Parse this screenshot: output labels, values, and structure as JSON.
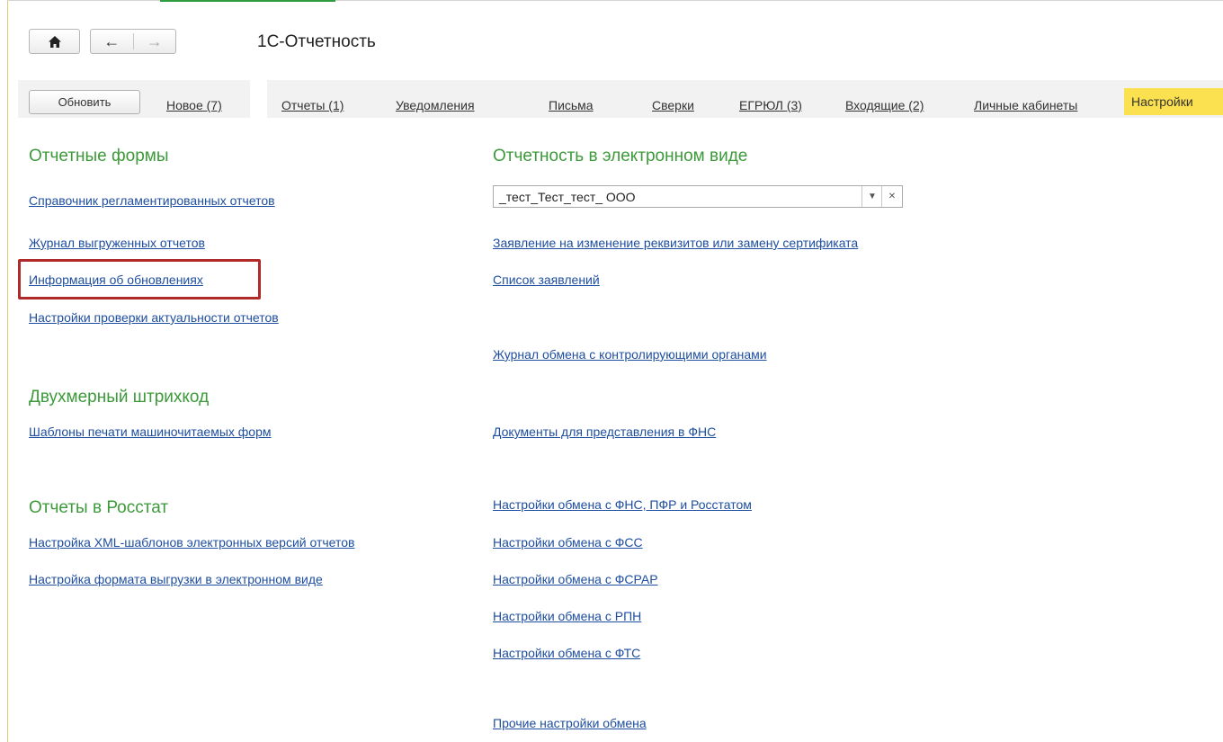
{
  "app": {
    "title": "1С-Отчетность"
  },
  "toolbar": {
    "refresh_label": "Обновить",
    "new_label": "Новое (7)"
  },
  "tabs": [
    {
      "label": "Отчеты (1)"
    },
    {
      "label": "Уведомления"
    },
    {
      "label": "Письма"
    },
    {
      "label": "Сверки"
    },
    {
      "label": "ЕГРЮЛ (3)"
    },
    {
      "label": "Входящие (2)"
    },
    {
      "label": "Личные кабинеты"
    },
    {
      "label": "Настройки"
    }
  ],
  "left": {
    "report_forms": {
      "title": "Отчетные формы",
      "links": [
        "Справочник регламентированных отчетов",
        "Журнал выгруженных отчетов",
        "Информация об обновлениях",
        "Настройки проверки актуальности отчетов"
      ]
    },
    "barcode": {
      "title": "Двухмерный штрихкод",
      "links": [
        "Шаблоны печати машиночитаемых форм"
      ]
    },
    "rosstat": {
      "title": "Отчеты в Росстат",
      "links": [
        "Настройка XML-шаблонов электронных версий отчетов",
        "Настройка формата выгрузки в электронном виде"
      ]
    }
  },
  "right": {
    "title": "Отчетность в электронном виде",
    "organization": {
      "value": "_тест_Тест_тест_ ООО"
    },
    "links": [
      "Заявление на изменение реквизитов или замену сертификата",
      "Список заявлений",
      "Журнал обмена с контролирующими органами",
      "Документы для представления в ФНС",
      "Настройки обмена с ФНС, ПФР и Росстатом",
      "Настройки обмена с ФСС",
      "Настройки обмена с ФСРАР",
      "Настройки обмена с РПН",
      "Настройки обмена с ФТС",
      "Прочие настройки обмена"
    ]
  },
  "icons": {
    "home": "home-icon",
    "back": "arrow-left-icon",
    "forward": "arrow-right-icon",
    "dropdown": "chevron-down-icon",
    "clear": "close-icon"
  },
  "colors": {
    "section_title": "#3d9a3a",
    "link": "#1e4ea0",
    "active_tab": "#fbe04f",
    "highlight": "#b02a2a"
  }
}
